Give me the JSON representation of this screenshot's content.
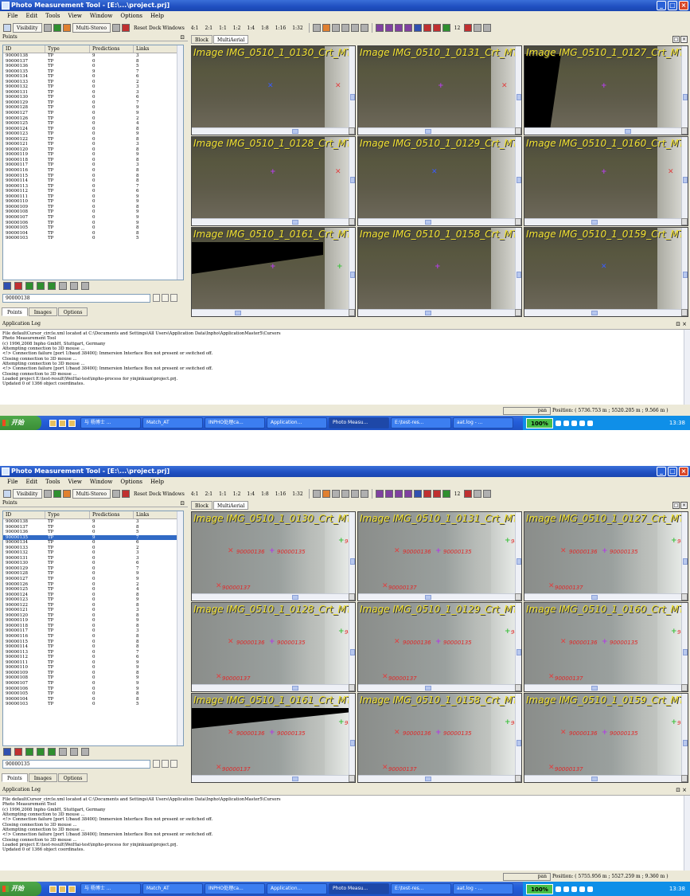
{
  "shots": [
    {
      "title": "Photo Measurement Tool - [E:\\...\\project.prj]",
      "selected_id": "",
      "search_value": "90000138",
      "status_mode": "pan",
      "position": "Position: ( 5736.753 m ; 5520.205 m ; 9.566 m )",
      "clock": "13:38",
      "images": [
        "Image IMG_0510_1_0130_Crt_MT",
        "Image IMG_0510_1_0131_Crt_MT",
        "Image IMG_0510_1_0127_Crt_MT",
        "Image IMG_0510_1_0128_Crt_MT",
        "Image IMG_0510_1_0129_Crt_MT",
        "Image IMG_0510_1_0160_Crt_MT",
        "Image IMG_0510_1_0161_Crt_MT",
        "Image IMG_0510_1_0158_Crt_MT",
        "Image IMG_0510_1_0159_Crt_MT"
      ]
    },
    {
      "title": "Photo Measurement Tool - [E:\\...\\project.prj]",
      "selected_id": "90000135",
      "search_value": "90000135",
      "status_mode": "pan",
      "position": "Position: ( 5755.956 m ; 5527.259 m ; 9.360 m )",
      "clock": "13:38",
      "images": [
        "Image IMG_0510_1_0130_Crt_MT",
        "Image IMG_0510_1_0131_Crt_MT",
        "Image IMG_0510_1_0127_Crt_MT",
        "Image IMG_0510_1_0128_Crt_MT",
        "Image IMG_0510_1_0129_Crt_MT",
        "Image IMG_0510_1_0160_Crt_MT",
        "Image IMG_0510_1_0161_Crt_MT",
        "Image IMG_0510_1_0158_Crt_MT",
        "Image IMG_0510_1_0159_Crt_MT"
      ],
      "marker_labels": {
        "a": "90000136",
        "b": "90000135",
        "c": "90000137",
        "d": "90"
      }
    }
  ],
  "menu": [
    "File",
    "Edit",
    "Tools",
    "View",
    "Window",
    "Options",
    "Help"
  ],
  "toolbar": {
    "visibility": "Visibility",
    "multistereo": "Multi-Stereo",
    "reset_dock": "Reset Dock Windows",
    "zooms": [
      "4:1",
      "2:1",
      "1:1",
      "1:2",
      "1:4",
      "1:8",
      "1:16",
      "1:32"
    ],
    "badge": "12"
  },
  "points_panel": {
    "title": "Points",
    "columns": [
      "ID",
      "Type",
      "Predictions",
      "Links"
    ],
    "rows": [
      [
        "90000138",
        "TP",
        "9",
        "3"
      ],
      [
        "90000137",
        "TP",
        "0",
        "8"
      ],
      [
        "90000136",
        "TP",
        "0",
        "5"
      ],
      [
        "90000135",
        "TP",
        "9",
        "7"
      ],
      [
        "90000134",
        "TP",
        "0",
        "6"
      ],
      [
        "90000133",
        "TP",
        "0",
        "2"
      ],
      [
        "90000132",
        "TP",
        "0",
        "3"
      ],
      [
        "90000131",
        "TP",
        "0",
        "3"
      ],
      [
        "90000130",
        "TP",
        "0",
        "6"
      ],
      [
        "90000129",
        "TP",
        "0",
        "7"
      ],
      [
        "90000128",
        "TP",
        "0",
        "9"
      ],
      [
        "90000127",
        "TP",
        "0",
        "9"
      ],
      [
        "90000126",
        "TP",
        "0",
        "2"
      ],
      [
        "90000125",
        "TP",
        "0",
        "4"
      ],
      [
        "90000124",
        "TP",
        "0",
        "8"
      ],
      [
        "90000123",
        "TP",
        "0",
        "9"
      ],
      [
        "90000122",
        "TP",
        "0",
        "8"
      ],
      [
        "90000121",
        "TP",
        "0",
        "3"
      ],
      [
        "90000120",
        "TP",
        "0",
        "8"
      ],
      [
        "90000119",
        "TP",
        "0",
        "9"
      ],
      [
        "90000118",
        "TP",
        "0",
        "8"
      ],
      [
        "90000117",
        "TP",
        "0",
        "3"
      ],
      [
        "90000116",
        "TP",
        "0",
        "8"
      ],
      [
        "90000115",
        "TP",
        "0",
        "8"
      ],
      [
        "90000114",
        "TP",
        "0",
        "8"
      ],
      [
        "90000113",
        "TP",
        "0",
        "7"
      ],
      [
        "90000112",
        "TP",
        "0",
        "6"
      ],
      [
        "90000111",
        "TP",
        "0",
        "9"
      ],
      [
        "90000110",
        "TP",
        "0",
        "9"
      ],
      [
        "90000109",
        "TP",
        "0",
        "8"
      ],
      [
        "90000108",
        "TP",
        "0",
        "9"
      ],
      [
        "90000107",
        "TP",
        "0",
        "9"
      ],
      [
        "90000106",
        "TP",
        "0",
        "9"
      ],
      [
        "90000105",
        "TP",
        "0",
        "8"
      ],
      [
        "90000104",
        "TP",
        "0",
        "8"
      ],
      [
        "90000103",
        "TP",
        "0",
        "5"
      ]
    ],
    "tabs": [
      "Points",
      "Images",
      "Options"
    ]
  },
  "view_panel": {
    "tabs": [
      "Block",
      "MultiAerial"
    ]
  },
  "log": {
    "title": "Application Log",
    "lines": [
      "File defaultCursor_circle.xml located at C:\\Documents and Settings\\All Users\\Application Data\\Inpho\\ApplicationMaster5\\Cursors",
      "Photo Measurement Tool",
      "(c) 1996,2008 Inpho GmbH, Stuttgart, Germany",
      "Attempting connection to 3D mouse ...",
      "<!> Connection failure [port 1/baud 38400]: Immersion Interface Box not present or switched off.",
      "Closing connection to 3D mouse ...",
      "Attempting connection to 3D mouse ...",
      "<!> Connection failure [port 1/baud 38400]: Immersion Interface Box not present or switched off.",
      "Closing connection to 3D mouse ...",
      "Loaded project E:\\test-result\\WeiHai-test\\inpho-process for yinjinkuan\\project.prj.",
      "Updated 0 of 1366 object coordinates."
    ]
  },
  "taskbar": {
    "start": "开始",
    "tasks": [
      "与 杨博士 ...",
      "Match_AT",
      "INPHO处理ca...",
      "Application...",
      "Photo Measu...",
      "E:\\test-res...",
      "aat.log - ..."
    ],
    "zoom": "100%"
  },
  "colors": {
    "title_blue": "#1f4fc0",
    "selection": "#316ac5",
    "image_title_yellow": "#f0e030",
    "marker_red": "#e02828",
    "marker_blue": "#3a5cff"
  }
}
